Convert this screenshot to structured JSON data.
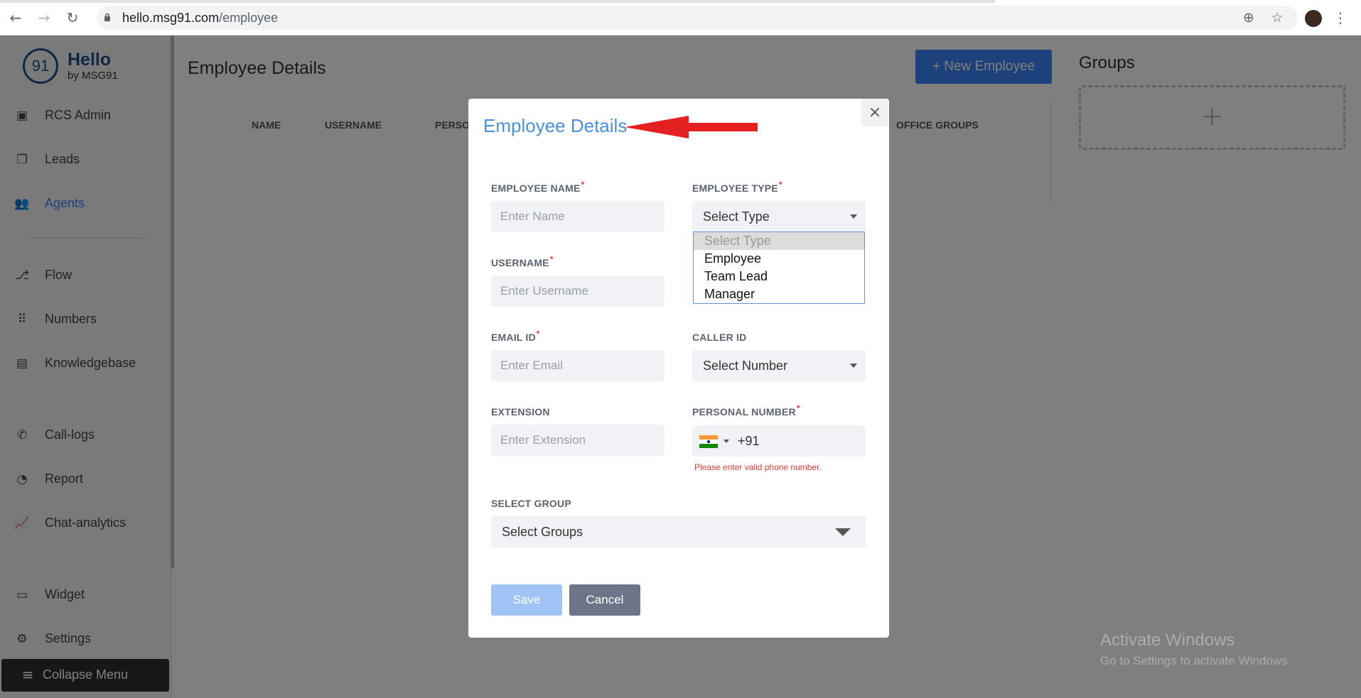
{
  "browser": {
    "url_host": "hello.msg91.com",
    "url_path": "/employee",
    "back_icon": "back-arrow-icon",
    "forward_icon": "forward-arrow-icon",
    "reload_icon": "reload-icon"
  },
  "logo": {
    "mark": "91",
    "title": "Hello",
    "subtitle": "by MSG91"
  },
  "sidebar": {
    "items": [
      {
        "label": "RCS Admin",
        "icon": "badge-icon"
      },
      {
        "label": "Leads",
        "icon": "layers-icon"
      },
      {
        "label": "Agents",
        "icon": "users-icon",
        "active": true
      },
      {
        "label": "Flow",
        "icon": "flow-icon"
      },
      {
        "label": "Numbers",
        "icon": "dialpad-icon"
      },
      {
        "label": "Knowledgebase",
        "icon": "document-icon"
      },
      {
        "label": "Call-logs",
        "icon": "phone-icon"
      },
      {
        "label": "Report",
        "icon": "pie-chart-icon"
      },
      {
        "label": "Chat-analytics",
        "icon": "line-chart-icon"
      },
      {
        "label": "Widget",
        "icon": "chat-icon"
      },
      {
        "label": "Settings",
        "icon": "gear-icon"
      }
    ],
    "collapse_label": "Collapse Menu"
  },
  "main": {
    "title": "Employee Details",
    "new_button": "+ New Employee",
    "columns": [
      "NAME",
      "USERNAME",
      "PERSO",
      "OFFICE GROUPS"
    ]
  },
  "groups": {
    "title": "Groups",
    "add_symbol": "+"
  },
  "modal": {
    "title": "Employee Details",
    "close": "×",
    "employee_name": {
      "label": "EMPLOYEE NAME",
      "placeholder": "Enter Name",
      "required": "*"
    },
    "employee_type": {
      "label": "EMPLOYEE TYPE",
      "required": "*",
      "value": "Select Type",
      "options": [
        "Select Type",
        "Employee",
        "Team Lead",
        "Manager"
      ]
    },
    "username": {
      "label": "USERNAME",
      "placeholder": "Enter Username",
      "required": "*"
    },
    "email": {
      "label": "EMAIL ID",
      "placeholder": "Enter Email",
      "required": "*"
    },
    "caller_id": {
      "label": "CALLER ID",
      "value": "Select Number"
    },
    "extension": {
      "label": "EXTENSION",
      "placeholder": "Enter Extension"
    },
    "personal_number": {
      "label": "PERSONAL NUMBER",
      "required": "*",
      "dial_code": "+91",
      "error": "Please enter valid phone number."
    },
    "select_group": {
      "label": "SELECT GROUP",
      "value": "Select Groups"
    },
    "save": "Save",
    "cancel": "Cancel"
  },
  "watermark": {
    "line1": "Activate Windows",
    "line2": "Go to Settings to activate Windows."
  },
  "colors": {
    "accent": "#3b82f6",
    "title_blue": "#4a90e2",
    "error": "#e53935",
    "arrow": "#e52020"
  }
}
